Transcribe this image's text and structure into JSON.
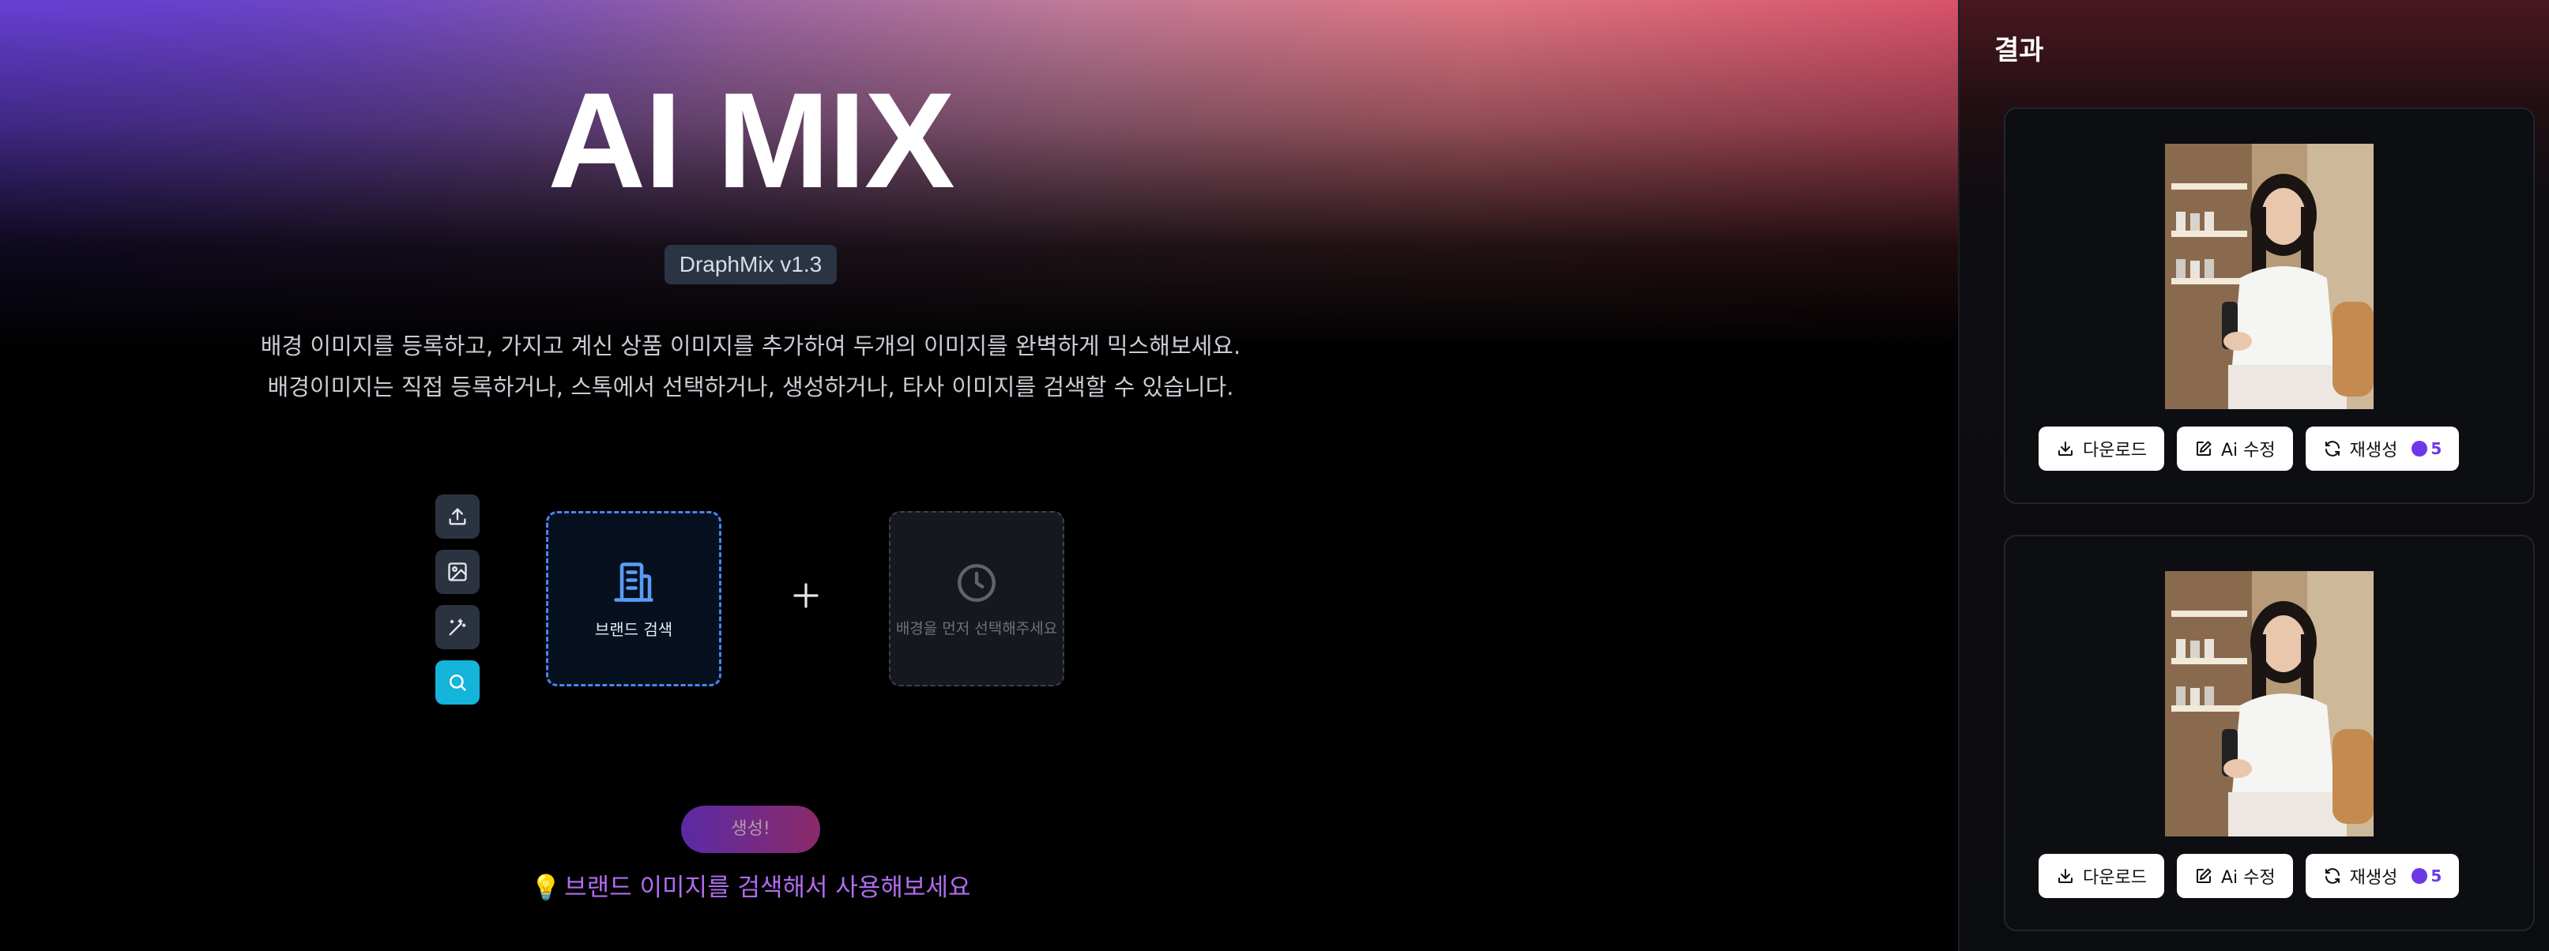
{
  "app": {
    "title": "AI MIX",
    "version": "DraphMix v1.3",
    "description_line1": "배경 이미지를 등록하고, 가지고 계신 상품 이미지를 추가하여 두개의 이미지를 완벽하게 믹스해보세요.",
    "description_line2": "배경이미지는 직접 등록하거나, 스톡에서 선택하거나, 생성하거나, 타사 이미지를 검색할 수 있습니다."
  },
  "tools": [
    {
      "name": "upload-icon"
    },
    {
      "name": "image-icon"
    },
    {
      "name": "magic-wand-icon"
    },
    {
      "name": "search-icon",
      "active": true
    }
  ],
  "slots": {
    "brand_label": "브랜드 검색",
    "background_label": "배경을 먼저 선택해주세요"
  },
  "generate_button": "생성!",
  "hint": "브랜드 이미지를 검색해서 사용해보세요",
  "results": {
    "title": "결과",
    "cards": [
      {
        "download": "다운로드",
        "edit": "Ai 수정",
        "regenerate": "재생성",
        "credit": "5"
      },
      {
        "download": "다운로드",
        "edit": "Ai 수정",
        "regenerate": "재생성",
        "credit": "5"
      }
    ]
  },
  "colors": {
    "accent_cyan": "#14b4db",
    "brand_border": "#4a86f0",
    "hint": "#b06cf0",
    "credit": "#6b39e6"
  }
}
